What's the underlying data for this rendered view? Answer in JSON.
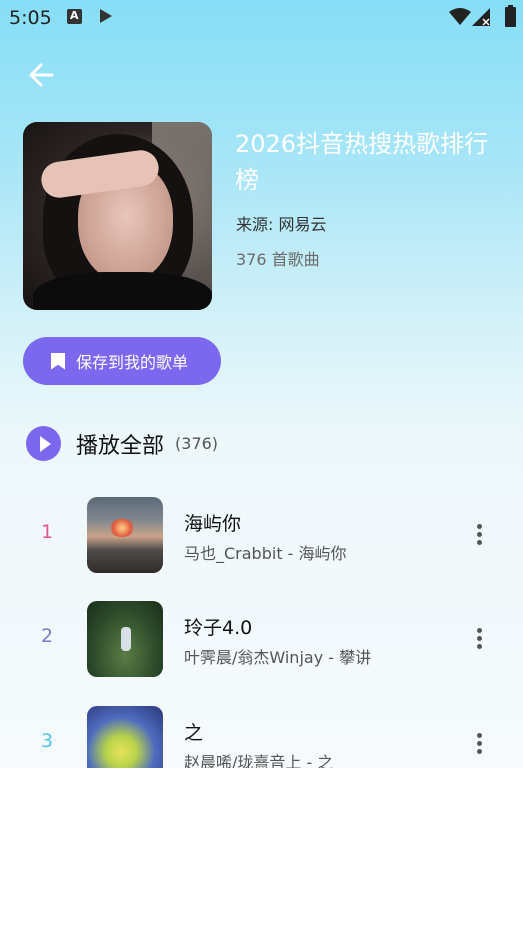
{
  "status_bar": {
    "time": "5:05",
    "icons": [
      "a-notification-icon",
      "play-notification-icon",
      "wifi-icon",
      "cell-signal-icon",
      "battery-icon"
    ]
  },
  "header": {
    "back_icon": "arrow-left-icon",
    "title": "2026抖音热搜热歌排行榜",
    "source": "来源: 网易云",
    "song_count": "376 首歌曲",
    "save_button": "保存到我的歌单"
  },
  "play_all": {
    "label": "播放全部",
    "count": "(376)"
  },
  "songs": [
    {
      "index": "1",
      "title": "海屿你",
      "artist": "马也_Crabbit - 海屿你",
      "index_color": "#e0568c"
    },
    {
      "index": "2",
      "title": "玲子4.0",
      "artist": "叶霁晨/翁杰Winjay - 攀讲",
      "index_color": "#7b78c9"
    },
    {
      "index": "3",
      "title": "之",
      "artist": "赵晨唏/珑熹音上 - 之",
      "index_color": "#55c4e6"
    }
  ],
  "colors": {
    "accent": "#7c68ee",
    "gradient_top": "#86def6",
    "gradient_bottom": "#f6fafc"
  }
}
